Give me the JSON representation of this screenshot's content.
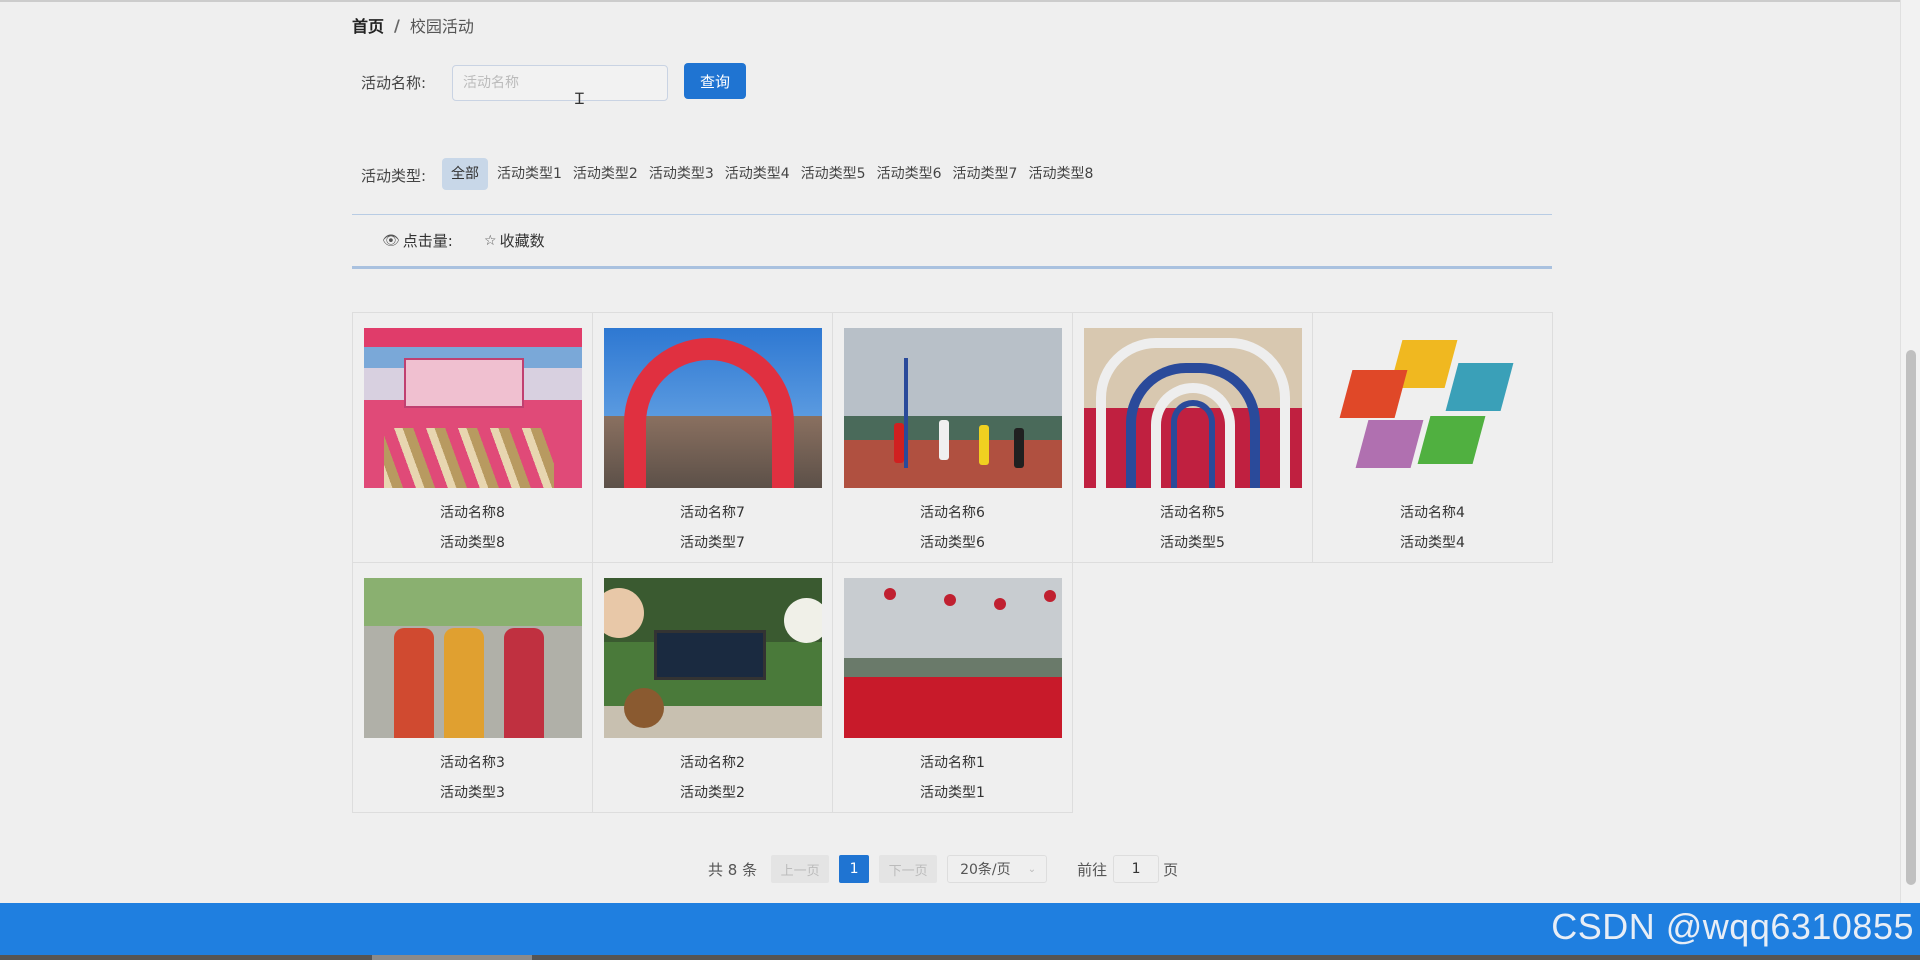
{
  "breadcrumb": {
    "home": "首页",
    "separator": "/",
    "current": "校园活动"
  },
  "search": {
    "label": "活动名称:",
    "placeholder": "活动名称",
    "value": "",
    "button": "查询"
  },
  "type_filter": {
    "label": "活动类型:",
    "items": [
      "全部",
      "活动类型1",
      "活动类型2",
      "活动类型3",
      "活动类型4",
      "活动类型5",
      "活动类型6",
      "活动类型7",
      "活动类型8"
    ],
    "selected": "全部"
  },
  "sort": {
    "clicks": "点击量:",
    "favorites": "收藏数"
  },
  "activities": [
    {
      "name": "活动名称8",
      "type": "活动类型8"
    },
    {
      "name": "活动名称7",
      "type": "活动类型7"
    },
    {
      "name": "活动名称6",
      "type": "活动类型6"
    },
    {
      "name": "活动名称5",
      "type": "活动类型5"
    },
    {
      "name": "活动名称4",
      "type": "活动类型4"
    },
    {
      "name": "活动名称3",
      "type": "活动类型3"
    },
    {
      "name": "活动名称2",
      "type": "活动类型2"
    },
    {
      "name": "活动名称1",
      "type": "活动类型1"
    }
  ],
  "pagination": {
    "total": "共 8 条",
    "prev": "上一页",
    "current_page": "1",
    "next": "下一页",
    "page_size": "20条/页",
    "goto_label": "前往",
    "goto_value": "1",
    "page_suffix": "页"
  },
  "watermark": "CSDN @wqq6310855",
  "colors": {
    "primary": "#1f74d2",
    "footer": "#1f7fe0",
    "active_tag": "#c8d7e8"
  }
}
